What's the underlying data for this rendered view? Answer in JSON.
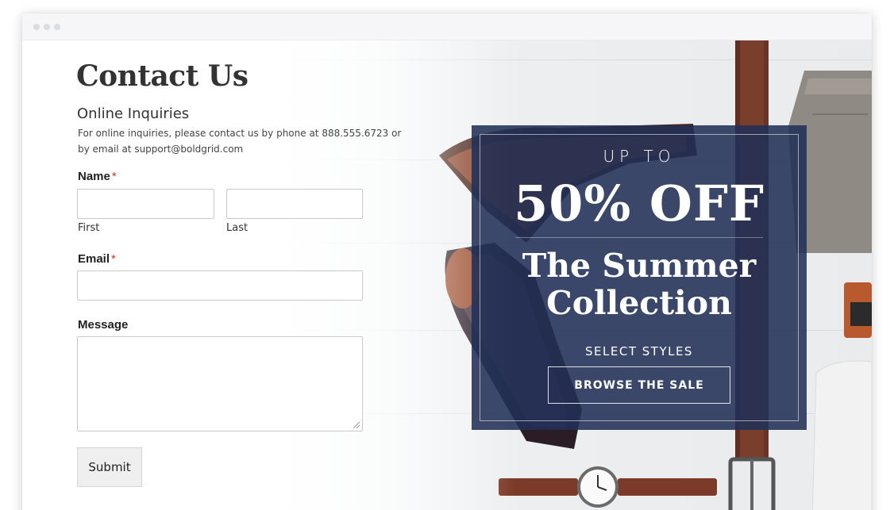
{
  "page": {
    "title": "Contact Us",
    "subtitle": "Online Inquiries",
    "intro": "For online inquiries, please contact us by phone at 888.555.6723 or by email at support@boldgrid.com"
  },
  "form": {
    "name_label": "Name",
    "required_mark": "*",
    "first_label": "First",
    "last_label": "Last",
    "email_label": "Email",
    "message_label": "Message",
    "submit_label": "Submit",
    "first_value": "",
    "last_value": "",
    "email_value": "",
    "message_value": ""
  },
  "promo": {
    "upto": "UP TO",
    "discount": "50% OFF",
    "collection": "The Summer Collection",
    "select_label": "SELECT STYLES",
    "button_label": "BROWSE THE SALE"
  },
  "colors": {
    "promo_bg": "#213056",
    "required": "#c0392b",
    "title": "#333333"
  }
}
